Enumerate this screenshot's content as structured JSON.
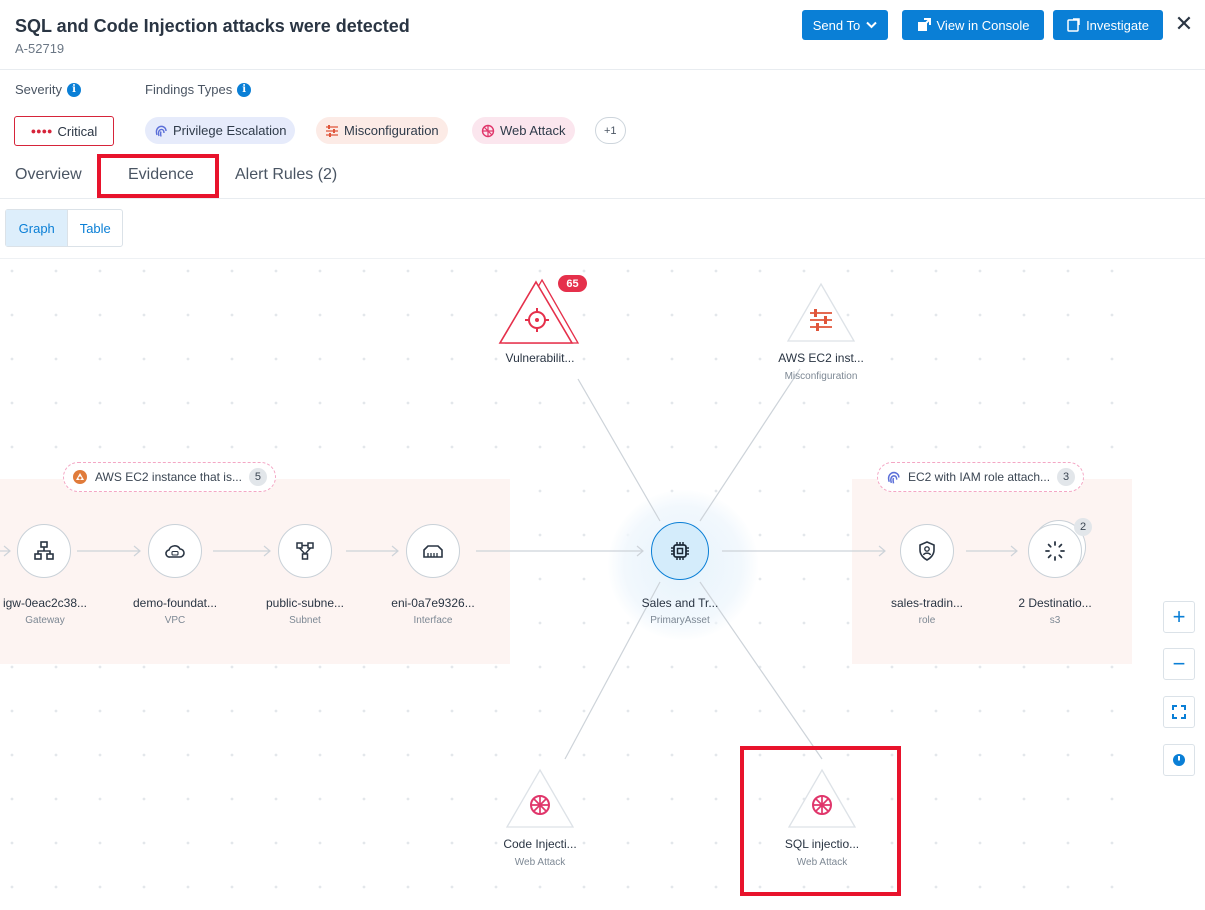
{
  "header": {
    "title": "SQL and Code Injection attacks were detected",
    "alert_id": "A-52719",
    "send_to_label": "Send To",
    "view_console_label": "View in Console",
    "investigate_label": "Investigate",
    "close_glyph": "✕"
  },
  "details": {
    "severity_label": "Severity",
    "findings_types_label": "Findings Types",
    "severity_value": "Critical",
    "findings": [
      {
        "label": "Privilege Escalation",
        "icon": "fingerprint-icon",
        "color": "#5b6fd8",
        "bg": "#e6ebfb"
      },
      {
        "label": "Misconfiguration",
        "icon": "sliders-icon",
        "color": "#e0553a",
        "bg": "#fcebe6"
      },
      {
        "label": "Web Attack",
        "icon": "bug-globe-icon",
        "color": "#e0366b",
        "bg": "#fbe6ee"
      }
    ],
    "more_findings": "+1"
  },
  "tabs": [
    {
      "label": "Overview"
    },
    {
      "label": "Evidence",
      "active": true
    },
    {
      "label": "Alert Rules (2)"
    }
  ],
  "view_toggle": {
    "graph": "Graph",
    "table": "Table",
    "selected": "Graph"
  },
  "graph": {
    "group_left": {
      "label": "AWS EC2 instance that is...",
      "count": "5"
    },
    "group_right": {
      "label": "EC2 with IAM role attach...",
      "count": "3"
    },
    "nodes": {
      "gateway": {
        "label": "igw-0eac2c38...",
        "type": "Gateway"
      },
      "vpc": {
        "label": "demo-foundat...",
        "type": "VPC"
      },
      "subnet": {
        "label": "public-subne...",
        "type": "Subnet"
      },
      "interface": {
        "label": "eni-0a7e9326...",
        "type": "Interface"
      },
      "primary": {
        "label": "Sales and Tr...",
        "type": "PrimaryAsset"
      },
      "role": {
        "label": "sales-tradin...",
        "type": "role"
      },
      "destinations": {
        "label": "2 Destinatio...",
        "type": "s3",
        "count": "2"
      },
      "vulnerability": {
        "label": "Vulnerabilit...",
        "count": "65"
      },
      "misconfig": {
        "label": "AWS EC2 inst...",
        "type": "Misconfiguration"
      },
      "code_injection": {
        "label": "Code Injecti...",
        "type": "Web Attack"
      },
      "sql_injection": {
        "label": "SQL injectio...",
        "type": "Web Attack"
      }
    }
  },
  "zoom": {
    "zoom_in": "+",
    "zoom_out": "−"
  },
  "colors": {
    "accent": "#0a7fd6",
    "critical": "#d6243a",
    "highlight": "#e8132c"
  }
}
